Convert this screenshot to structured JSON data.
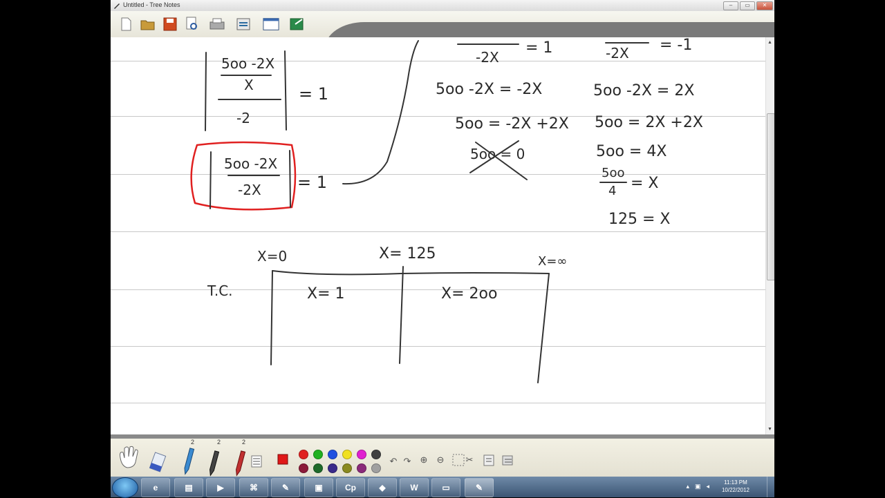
{
  "window": {
    "title": "Untitled - Tree Notes"
  },
  "notes": {
    "eq1": {
      "numerator": "5oo -2X",
      "denom_inner": "X",
      "denominator": "-2",
      "rhs": "= 1"
    },
    "eq2": {
      "numerator": "5oo -2X",
      "denominator": "-2X",
      "rhs": "= 1"
    },
    "top_left_frac": {
      "denominator": "-2X",
      "rhs": "= 1"
    },
    "top_right_frac": {
      "denominator": "-2X",
      "rhs": "= -1"
    },
    "caseA": [
      "5oo -2X = -2X",
      "5oo = -2X +2X",
      "5oo = 0"
    ],
    "caseB": [
      "5oo -2X = 2X",
      "5oo = 2X +2X",
      "5oo = 4X",
      "= X",
      "125 = X"
    ],
    "caseB_frac": {
      "numerator": "5oo",
      "denominator": "4"
    },
    "test": {
      "label": "T.C.",
      "points": [
        "X=0",
        "X= 125",
        "X=∞"
      ],
      "tests": [
        "X= 1",
        "X= 2oo"
      ]
    }
  },
  "toolbar": {
    "buttons": [
      "new-page-icon",
      "open-folder-icon",
      "save-icon",
      "print-preview-icon",
      "print-icon",
      "scan-icon",
      "window-icon",
      "export-icon"
    ]
  },
  "palette": {
    "pen_sizes": [
      "2",
      "2",
      "2"
    ],
    "colors_row1": [
      "#e02020",
      "#20b020",
      "#2050e0",
      "#f0e020",
      "#e020d0",
      "#404040"
    ],
    "colors_row2": [
      "#8b1a3a",
      "#1f6a2a",
      "#3a2a8a",
      "#8a8a20",
      "#8a2a7a",
      "#a0a0a0"
    ]
  },
  "taskbar": {
    "clock_time": "11:13 PM",
    "clock_date": "10/22/2012"
  }
}
